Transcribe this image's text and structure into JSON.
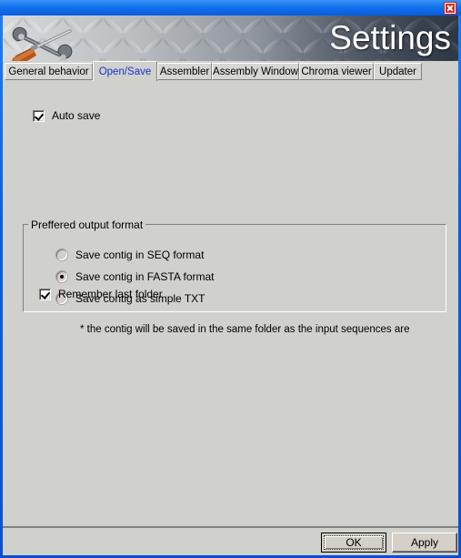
{
  "window": {
    "banner_title": "Settings",
    "close_icon": "close-icon"
  },
  "tabs": [
    {
      "label": "General behavior",
      "active": false
    },
    {
      "label": "Open/Save",
      "active": true
    },
    {
      "label": "Assembler",
      "active": false
    },
    {
      "label": "Assembly Window",
      "active": false
    },
    {
      "label": "Chroma viewer",
      "active": false
    },
    {
      "label": "Updater",
      "active": false
    }
  ],
  "options": {
    "auto_save_label": "Auto save",
    "auto_save_checked": true,
    "remember_last_folder_label": "Remember last folder",
    "remember_last_folder_checked": true
  },
  "group": {
    "title": "Preffered output format",
    "radios": [
      {
        "label": "Save contig in SEQ format",
        "selected": false
      },
      {
        "label": "Save contig in FASTA format",
        "selected": true
      },
      {
        "label": "Save contig as simple TXT",
        "selected": false
      }
    ]
  },
  "note": "* the contig will be saved in the same folder as the input sequences are",
  "footer": {
    "ok_label": "OK",
    "apply_label": "Apply"
  },
  "colors": {
    "window_border": "#0a5fe0",
    "titlebar": "#1173ee",
    "face": "#d0d0cd",
    "active_tab_text": "#1a34c8",
    "close_red": "#d42a2a"
  }
}
